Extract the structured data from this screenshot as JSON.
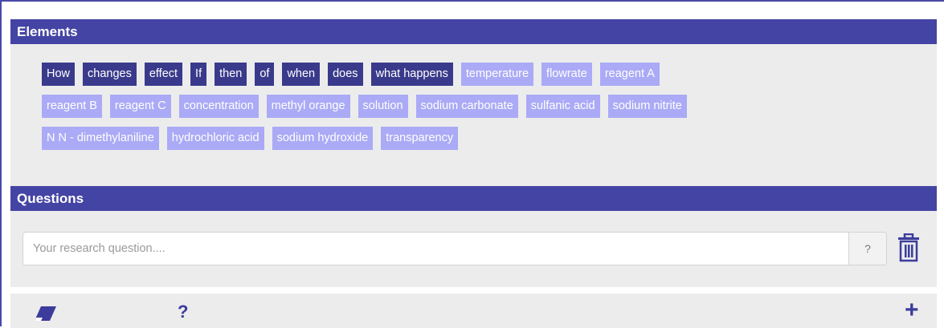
{
  "elements": {
    "header": "Elements",
    "rows": [
      [
        {
          "label": "How",
          "kind": "dark"
        },
        {
          "label": "changes",
          "kind": "dark"
        },
        {
          "label": "effect",
          "kind": "dark"
        },
        {
          "label": "If",
          "kind": "dark"
        },
        {
          "label": "then",
          "kind": "dark"
        },
        {
          "label": "of",
          "kind": "dark"
        },
        {
          "label": "when",
          "kind": "dark"
        },
        {
          "label": "does",
          "kind": "dark"
        },
        {
          "label": "what happens",
          "kind": "dark"
        },
        {
          "label": "temperature",
          "kind": "light"
        },
        {
          "label": "flowrate",
          "kind": "light"
        },
        {
          "label": "reagent A",
          "kind": "light"
        }
      ],
      [
        {
          "label": "reagent B",
          "kind": "light"
        },
        {
          "label": "reagent C",
          "kind": "light"
        },
        {
          "label": "concentration",
          "kind": "light"
        },
        {
          "label": "methyl orange",
          "kind": "light"
        },
        {
          "label": "solution",
          "kind": "light"
        },
        {
          "label": "sodium carbonate",
          "kind": "light"
        },
        {
          "label": "sulfanic acid",
          "kind": "light"
        },
        {
          "label": "sodium nitrite",
          "kind": "light"
        }
      ],
      [
        {
          "label": "N N - dimethylaniline",
          "kind": "light"
        },
        {
          "label": "hydrochloric acid",
          "kind": "light"
        },
        {
          "label": "sodium hydroxide",
          "kind": "light"
        },
        {
          "label": "transparency",
          "kind": "light"
        }
      ]
    ]
  },
  "questions": {
    "header": "Questions",
    "input_placeholder": "Your research question....",
    "input_value": "",
    "help_label": "?",
    "delete_icon": "trash-icon"
  },
  "footer": {
    "eraser_icon": "eraser-icon",
    "help_label": "?",
    "add_label": "+"
  },
  "colors": {
    "header_bg": "#4444a4",
    "chip_dark": "#3a3a8c",
    "chip_light": "#aaaaf6",
    "panel_bg": "#ececec"
  }
}
